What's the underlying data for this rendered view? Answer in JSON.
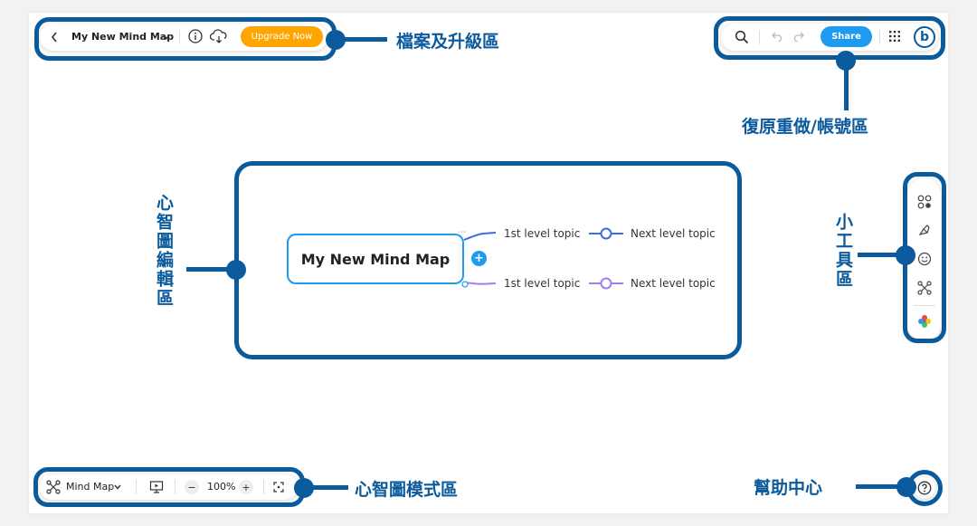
{
  "top_bar": {
    "back_icon": "chevron-left-icon",
    "file_title": "My New Mind Map",
    "info_icon": "info-icon",
    "cloud_icon": "cloud-sync-icon",
    "upgrade_label": "Upgrade Now",
    "upgrade_color": "#ffa500"
  },
  "right_bar": {
    "search_icon": "search-icon",
    "undo_icon": "undo-icon",
    "redo_icon": "redo-icon",
    "share_label": "Share",
    "share_color": "#1e9bf0",
    "apps_icon": "grid-icon",
    "avatar_letter": "b"
  },
  "mind_map": {
    "central_topic": "My New Mind Map",
    "branches": [
      {
        "topic": "1st level topic",
        "child": "Next level topic",
        "color": "#3a6de0"
      },
      {
        "topic": "1st level topic",
        "child": "Next level topic",
        "color": "#a37ef0"
      }
    ]
  },
  "side_tools": [
    "layout-icon",
    "style-brush-icon",
    "sticker-icon",
    "structure-icon",
    "theme-flower-icon"
  ],
  "bottom_bar": {
    "mode_icon": "mindmap-icon",
    "mode_label": "Mind Map",
    "present_icon": "presentation-icon",
    "zoom_out": "−",
    "zoom_level": "100%",
    "zoom_in": "+",
    "fit_icon": "fit-screen-icon"
  },
  "help_icon": "help-icon",
  "annotations": {
    "file_upgrade": "檔案及升級區",
    "undo_account": "復原重做/帳號區",
    "editor": "心智圖編輯區",
    "tools": "小工具區",
    "mode": "心智圖模式區",
    "help": "幫助中心"
  }
}
